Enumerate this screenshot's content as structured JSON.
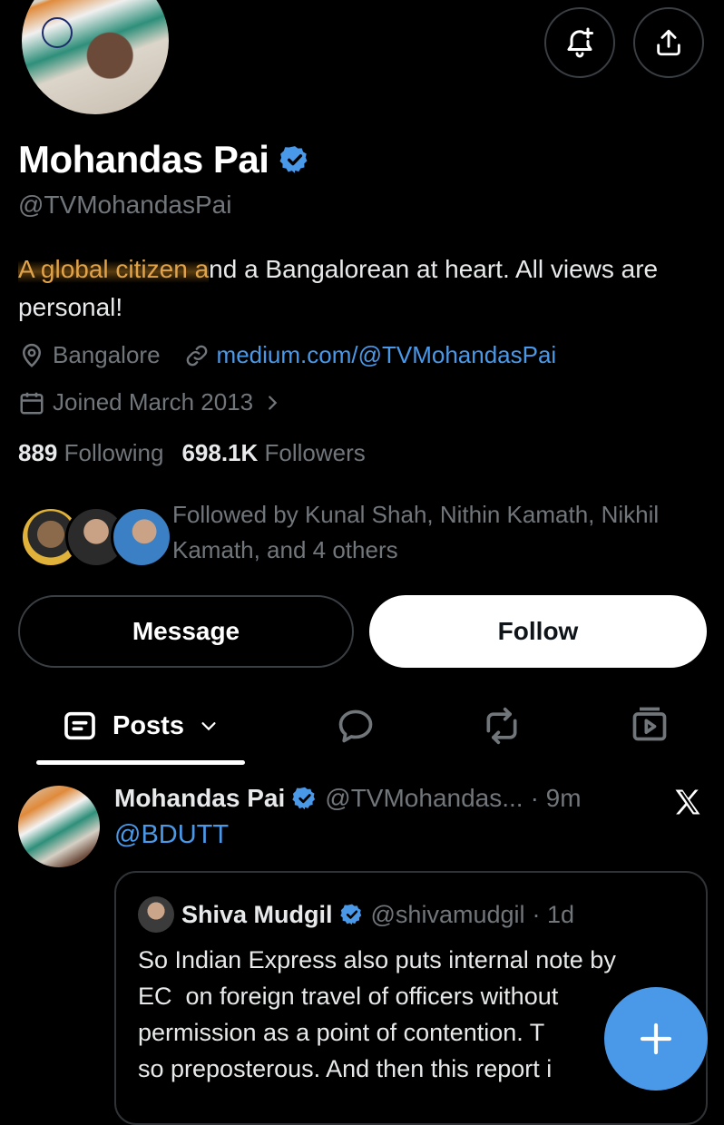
{
  "profile": {
    "name": "Mohandas Pai",
    "handle": "@TVMohandasPai",
    "bio_highlight": "A global citizen a",
    "bio_rest": "nd a Bangalorean at heart. All views are personal!",
    "location": "Bangalore",
    "website": "medium.com/@TVMohandasPai",
    "joined": "Joined March 2013",
    "following_count": "889",
    "following_label": "Following",
    "followers_count": "698.1K",
    "followers_label": "Followers",
    "followed_by": "Followed by Kunal Shah, Nithin Kamath, Nikhil Kamath, and 4 others"
  },
  "header": {
    "notify_icon": "bell-plus-icon",
    "share_icon": "share-icon"
  },
  "actions": {
    "message_label": "Message",
    "follow_label": "Follow"
  },
  "tabs": {
    "posts_label": "Posts"
  },
  "post": {
    "author_name": "Mohandas Pai",
    "author_handle": "@TVMohandas...",
    "time": "· 9m",
    "reply_to": "@BDUTT",
    "quote": {
      "author_name": "Shiva Mudgil",
      "author_handle": "@shivamudgil",
      "time": "· 1d",
      "text_lines": [
        "So Indian Express also puts internal note by",
        "EC  on foreign travel of officers without",
        "permission as a point of contention. T",
        "so preposterous. And then this report i"
      ]
    }
  },
  "colors": {
    "background": "#000000",
    "text": "#e7e9ea",
    "muted": "#71767b",
    "accent": "#4a99e9",
    "verified": "#4a99e9"
  }
}
